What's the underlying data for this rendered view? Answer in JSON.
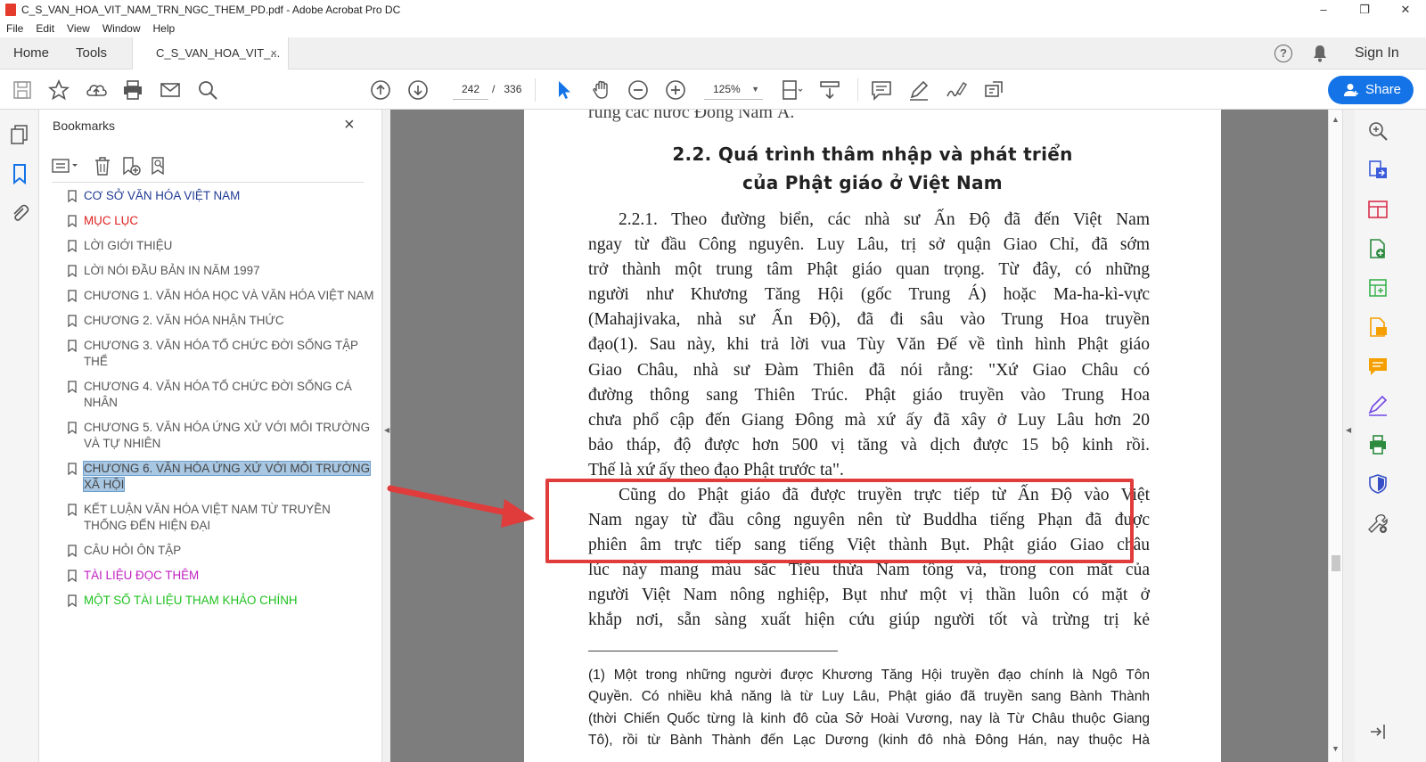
{
  "window": {
    "title": "C_S_VAN_HOA_VIT_NAM_TRN_NGC_THEM_PD.pdf - Adobe Acrobat Pro DC",
    "minimize": "–",
    "maximize": "❐",
    "close": "✕"
  },
  "menu": [
    "File",
    "Edit",
    "View",
    "Window",
    "Help"
  ],
  "tabs": {
    "home": "Home",
    "tools": "Tools",
    "document": "C_S_VAN_HOA_VIT_...",
    "document_close": "×",
    "help": "?",
    "sign_in": "Sign In"
  },
  "toolbar": {
    "current_page": "242",
    "page_separator": "/",
    "total_pages": "336",
    "zoom": "125%",
    "share_label": "Share"
  },
  "bookmarks": {
    "title": "Bookmarks",
    "close": "×",
    "items": [
      {
        "label": "CƠ SỞ VĂN HÓA VIỆT NAM",
        "color": "#1f3a93"
      },
      {
        "label": "MỤC LỤC",
        "color": "#e02020"
      },
      {
        "label": "LỜI GIỚI THIỆU",
        "color": "#555555"
      },
      {
        "label": "LỜI NÓI ĐẦU BẢN IN NĂM 1997",
        "color": "#555555"
      },
      {
        "label": "CHƯƠNG 1. VĂN HÓA HỌC VÀ VĂN HÓA VIỆT NAM",
        "color": "#555555"
      },
      {
        "label": "CHƯƠNG 2. VĂN HÓA NHẬN THỨC",
        "color": "#555555"
      },
      {
        "label": "CHƯƠNG 3. VĂN HÓA TỔ CHỨC ĐỜI SỐNG TẬP THỂ",
        "color": "#555555"
      },
      {
        "label": "CHƯƠNG 4. VĂN HÓA TỔ CHỨC ĐỜI SỐNG CÁ NHÂN",
        "color": "#555555"
      },
      {
        "label": "CHƯƠNG 5. VĂN HÓA ỨNG XỬ VỚI MÔI TRƯỜNG VÀ TỰ NHIÊN",
        "color": "#555555"
      },
      {
        "label": "CHƯƠNG 6. VĂN HÓA ỨNG XỬ VỚI MÔI TRƯỜNG XÃ HỘI",
        "color": "#444444",
        "selected": true
      },
      {
        "label": "KẾT LUẬN VĂN HÓA VIỆT NAM TỪ TRUYỀN THỐNG ĐẾN HIỆN ĐẠI",
        "color": "#555555"
      },
      {
        "label": "CÂU HỎI ÔN TẬP",
        "color": "#555555"
      },
      {
        "label": "TÀI LIỆU ĐỌC THÊM",
        "color": "#c020c0"
      },
      {
        "label": "MỘT SỐ TÀI LIỆU THAM KHẢO CHÍNH",
        "color": "#20c020"
      }
    ]
  },
  "document": {
    "cut_line": "rung các nước Đông Nam Á.",
    "heading_line1": "2.2. Quá trình thâm nhập và phát triển",
    "heading_line2": "của Phật giáo ở Việt Nam",
    "para1": [
      "2.2.1. Theo đường biển, các nhà sư Ấn Độ đã đến Việt Nam",
      "ngay từ đầu Công nguyên. Luy Lâu, trị sở quận Giao Chỉ, đã sớm",
      "trở thành một trung tâm Phật giáo quan trọng. Từ đây, có những",
      "người như Khương Tăng Hội (gốc Trung Á) hoặc Ma-ha-kì-vực",
      "(Mahajivaka, nhà sư Ấn Độ), đã đi sâu vào Trung Hoa truyền",
      "đạo(1). Sau này, khi trả lời vua Tùy Văn Đế về tình hình Phật giáo",
      "Giao Châu, nhà sư Đàm Thiên đã nói rằng: \"Xứ Giao Châu có",
      "đường thông sang Thiên Trúc. Phật giáo truyền vào Trung Hoa",
      "chưa phổ cập đến Giang Đông mà xứ ấy đã xây ở Luy Lâu hơn 20",
      "bảo tháp, độ được hơn 500 vị tăng và dịch được 15 bộ kinh rồi.",
      "Thế là xứ ấy theo đạo Phật trước ta\"."
    ],
    "para2": [
      "Cũng do Phật giáo đã được truyền trực tiếp từ Ấn Độ vào Việt",
      "Nam ngay từ đầu công nguyên nên từ Buddha tiếng Phạn đã được",
      "phiên âm trực tiếp sang tiếng Việt thành Bụt. Phật giáo Giao châu",
      "lúc này mang màu sắc Tiểu thừa Nam tông và, trong con mắt của",
      "người Việt Nam nông nghiệp, Bụt như một vị thần luôn có mặt ở",
      "khắp nơi, sẵn sàng xuất hiện cứu giúp người tốt và trừng trị kẻ"
    ],
    "footnote": [
      "(1) Một trong những người được Khương Tăng Hội truyền đạo chính là Ngô Tôn",
      "Quyền. Có nhiều khả năng là từ Luy Lâu, Phật giáo đã truyền sang Bành Thành",
      "(thời Chiến Quốc từng là kinh đô của Sở Hoài Vương, nay là Từ Châu thuộc Giang",
      "Tô), rồi từ Bành Thành đến Lạc Dương (kinh đô nhà Đông Hán, nay thuộc Hà"
    ]
  },
  "annotation_color": "#e03c3c"
}
